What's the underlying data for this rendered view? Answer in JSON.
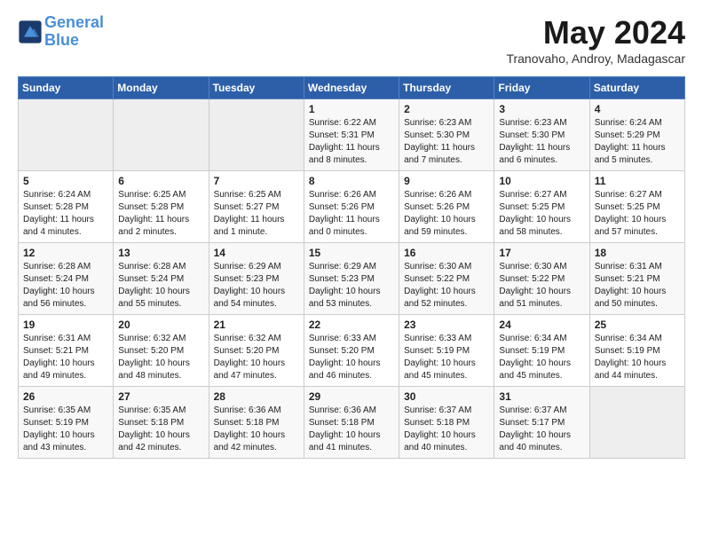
{
  "header": {
    "logo_line1": "General",
    "logo_line2": "Blue",
    "month_title": "May 2024",
    "subtitle": "Tranovaho, Androy, Madagascar"
  },
  "weekdays": [
    "Sunday",
    "Monday",
    "Tuesday",
    "Wednesday",
    "Thursday",
    "Friday",
    "Saturday"
  ],
  "weeks": [
    [
      null,
      null,
      null,
      {
        "day": 1,
        "sunrise": "6:22 AM",
        "sunset": "5:31 PM",
        "daylight": "11 hours and 8 minutes."
      },
      {
        "day": 2,
        "sunrise": "6:23 AM",
        "sunset": "5:30 PM",
        "daylight": "11 hours and 7 minutes."
      },
      {
        "day": 3,
        "sunrise": "6:23 AM",
        "sunset": "5:30 PM",
        "daylight": "11 hours and 6 minutes."
      },
      {
        "day": 4,
        "sunrise": "6:24 AM",
        "sunset": "5:29 PM",
        "daylight": "11 hours and 5 minutes."
      }
    ],
    [
      {
        "day": 5,
        "sunrise": "6:24 AM",
        "sunset": "5:28 PM",
        "daylight": "11 hours and 4 minutes."
      },
      {
        "day": 6,
        "sunrise": "6:25 AM",
        "sunset": "5:28 PM",
        "daylight": "11 hours and 2 minutes."
      },
      {
        "day": 7,
        "sunrise": "6:25 AM",
        "sunset": "5:27 PM",
        "daylight": "11 hours and 1 minute."
      },
      {
        "day": 8,
        "sunrise": "6:26 AM",
        "sunset": "5:26 PM",
        "daylight": "11 hours and 0 minutes."
      },
      {
        "day": 9,
        "sunrise": "6:26 AM",
        "sunset": "5:26 PM",
        "daylight": "10 hours and 59 minutes."
      },
      {
        "day": 10,
        "sunrise": "6:27 AM",
        "sunset": "5:25 PM",
        "daylight": "10 hours and 58 minutes."
      },
      {
        "day": 11,
        "sunrise": "6:27 AM",
        "sunset": "5:25 PM",
        "daylight": "10 hours and 57 minutes."
      }
    ],
    [
      {
        "day": 12,
        "sunrise": "6:28 AM",
        "sunset": "5:24 PM",
        "daylight": "10 hours and 56 minutes."
      },
      {
        "day": 13,
        "sunrise": "6:28 AM",
        "sunset": "5:24 PM",
        "daylight": "10 hours and 55 minutes."
      },
      {
        "day": 14,
        "sunrise": "6:29 AM",
        "sunset": "5:23 PM",
        "daylight": "10 hours and 54 minutes."
      },
      {
        "day": 15,
        "sunrise": "6:29 AM",
        "sunset": "5:23 PM",
        "daylight": "10 hours and 53 minutes."
      },
      {
        "day": 16,
        "sunrise": "6:30 AM",
        "sunset": "5:22 PM",
        "daylight": "10 hours and 52 minutes."
      },
      {
        "day": 17,
        "sunrise": "6:30 AM",
        "sunset": "5:22 PM",
        "daylight": "10 hours and 51 minutes."
      },
      {
        "day": 18,
        "sunrise": "6:31 AM",
        "sunset": "5:21 PM",
        "daylight": "10 hours and 50 minutes."
      }
    ],
    [
      {
        "day": 19,
        "sunrise": "6:31 AM",
        "sunset": "5:21 PM",
        "daylight": "10 hours and 49 minutes."
      },
      {
        "day": 20,
        "sunrise": "6:32 AM",
        "sunset": "5:20 PM",
        "daylight": "10 hours and 48 minutes."
      },
      {
        "day": 21,
        "sunrise": "6:32 AM",
        "sunset": "5:20 PM",
        "daylight": "10 hours and 47 minutes."
      },
      {
        "day": 22,
        "sunrise": "6:33 AM",
        "sunset": "5:20 PM",
        "daylight": "10 hours and 46 minutes."
      },
      {
        "day": 23,
        "sunrise": "6:33 AM",
        "sunset": "5:19 PM",
        "daylight": "10 hours and 45 minutes."
      },
      {
        "day": 24,
        "sunrise": "6:34 AM",
        "sunset": "5:19 PM",
        "daylight": "10 hours and 45 minutes."
      },
      {
        "day": 25,
        "sunrise": "6:34 AM",
        "sunset": "5:19 PM",
        "daylight": "10 hours and 44 minutes."
      }
    ],
    [
      {
        "day": 26,
        "sunrise": "6:35 AM",
        "sunset": "5:19 PM",
        "daylight": "10 hours and 43 minutes."
      },
      {
        "day": 27,
        "sunrise": "6:35 AM",
        "sunset": "5:18 PM",
        "daylight": "10 hours and 42 minutes."
      },
      {
        "day": 28,
        "sunrise": "6:36 AM",
        "sunset": "5:18 PM",
        "daylight": "10 hours and 42 minutes."
      },
      {
        "day": 29,
        "sunrise": "6:36 AM",
        "sunset": "5:18 PM",
        "daylight": "10 hours and 41 minutes."
      },
      {
        "day": 30,
        "sunrise": "6:37 AM",
        "sunset": "5:18 PM",
        "daylight": "10 hours and 40 minutes."
      },
      {
        "day": 31,
        "sunrise": "6:37 AM",
        "sunset": "5:17 PM",
        "daylight": "10 hours and 40 minutes."
      },
      null
    ]
  ]
}
